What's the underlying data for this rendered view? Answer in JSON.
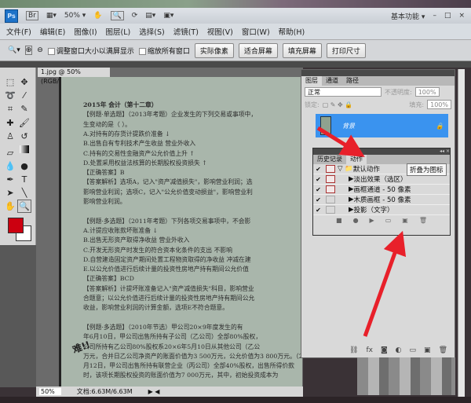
{
  "app": {
    "logo": "Ps",
    "bridge": "Br",
    "zoom": "50%",
    "workspace": "基本功能",
    "window_controls": [
      "–",
      "□",
      "×"
    ]
  },
  "menu": [
    "文件(F)",
    "编辑(E)",
    "图像(I)",
    "图层(L)",
    "选择(S)",
    "滤镜(T)",
    "视图(V)",
    "窗口(W)",
    "帮助(H)"
  ],
  "options": {
    "resize_windows": "调整窗口大小以满屏显示",
    "zoom_all": "缩放所有窗口",
    "actual_pixels": "实际像素",
    "fit_screen": "适合屏幕",
    "fill_screen": "填充屏幕",
    "print_size": "打印尺寸"
  },
  "document": {
    "tab": "1.jpg @ 50%(RGB/8#)",
    "tab_close": "×",
    "lines": [
      "2015年                                 会计（第十二章）",
      "【例题·单选题】（2013年考题）企业发生的下列交易或事项中，",
      "生变动的是（  ）。",
      "A.对持有的存货计提跌价准备   ↓",
      "B.出售自有专利技术产生收益   营业外收入",
      "C.持有的交易性金融资产公允价值上升   ↑",
      "D.处置采用权益法核算的长期股权投资损失   ↑",
      "【正确答案】B",
      "【答案解析】选项A，记入\"资产减值损失\"，影响营业利润；选",
      "影响营业利润；选项C，记入\"公允价值变动损益\"，影响营业利",
      "影响营业利润。",
      "",
      "【例题·多选题】（2011年考题）下列各项交易事项中，不会影",
      "A.计提应收账款坏账准备   ↓",
      "B.出售无形资产取得净收益   营业外收入",
      "C.开发无形资产时发生的符合资本化条件的支出   不影响",
      "D.自营建造固定资产期间处置工程物资取得的净收益   冲减在建",
      "E.以公允价值进行后续计量的投资性房地产持有期间公允价值",
      "【正确答案】BCD",
      "【答案解析】计提坏账准备记入\"资产减值损失\"科目，影响营业",
      "合题意；以公允价值进行后续计量的投资性房地产持有期间公允",
      "收益，影响营业利润的计算金额，选项E不符合题意。",
      "",
      "【例题·多选题】（2010年节选）甲公司20×9年度发生的有",
      "年6月10日，甲公司出售所持有子公司（乙公司）全部80%股权，",
      "公司所持有乙公司80%股权系20×6年5月10日从其他公司（乙公",
      "万元，合并日乙公司净资产的账面价值为3 500万元，公允价值为3 800万元。（2）",
      "月12日，甲公司出售所持有联营企业（丙公司）全部40%股权，出售所得价款",
      "时，该项长期股权投资的账面价值为7 000万元，其中，初始投资成本为"
    ],
    "handwritten_note": "难!!"
  },
  "status": {
    "zoom": "50%",
    "doc_size": "文档:6.63M/6.63M"
  },
  "layers_panel": {
    "tabs": [
      "图层",
      "通道",
      "路径"
    ],
    "blend_mode": "正常",
    "opacity_label": "不透明度:",
    "opacity": "100%",
    "lock_label": "锁定:",
    "fill_label": "填充:",
    "fill": "100%",
    "layer_name": "背景"
  },
  "actions_panel": {
    "tabs": [
      "历史记录",
      "动作"
    ],
    "set": "默认动作",
    "items": [
      "淡出效果（选区）",
      "画框通道 - 50 像素",
      "木质画框 - 50 像素",
      "投影（文字）"
    ]
  },
  "tooltip": "折叠为图标",
  "colors": {
    "accent": "#3a93ef",
    "arrow": "#e8202a",
    "foreground": "#cc0010"
  }
}
